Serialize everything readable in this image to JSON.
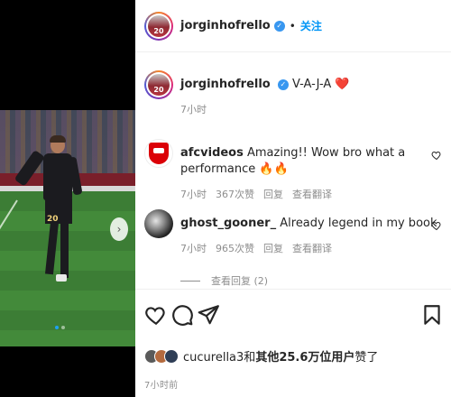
{
  "post": {
    "username": "jorginhofrello",
    "verified_icon": "verified-badge-icon",
    "separator": "•",
    "follow_label": "关注",
    "avatar_number": "20"
  },
  "media": {
    "next_label": "›",
    "jersey_number": "20",
    "carousel_dots": 2,
    "active_dot": 0
  },
  "caption": {
    "username": "jorginhofrello",
    "text": "V-A-J-A",
    "emoji": "❤️",
    "time": "7小时"
  },
  "comments": [
    {
      "username": "afcvideos",
      "text": "Amazing!! Wow bro what a performance 🔥🔥",
      "time": "7小时",
      "likes": "367次赞",
      "reply": "回复",
      "translate": "查看翻译"
    },
    {
      "username": "ghost_gooner_",
      "text": "Already legend in my book",
      "time": "7小时",
      "likes": "965次赞",
      "reply": "回复",
      "translate": "查看翻译"
    }
  ],
  "more_replies": "查看回复 (2)",
  "actions": {
    "icons": [
      "heart-icon",
      "comment-icon",
      "share-icon",
      "bookmark-icon"
    ]
  },
  "likes_summary": {
    "user": "cucurella3",
    "joiner": "和",
    "others": "其他25.6万位用户",
    "suffix": "赞了"
  },
  "timestamp": "7小时前",
  "colors": {
    "accent": "#0095f6",
    "verified": "#3897f0",
    "muted": "#8e8e8e"
  }
}
